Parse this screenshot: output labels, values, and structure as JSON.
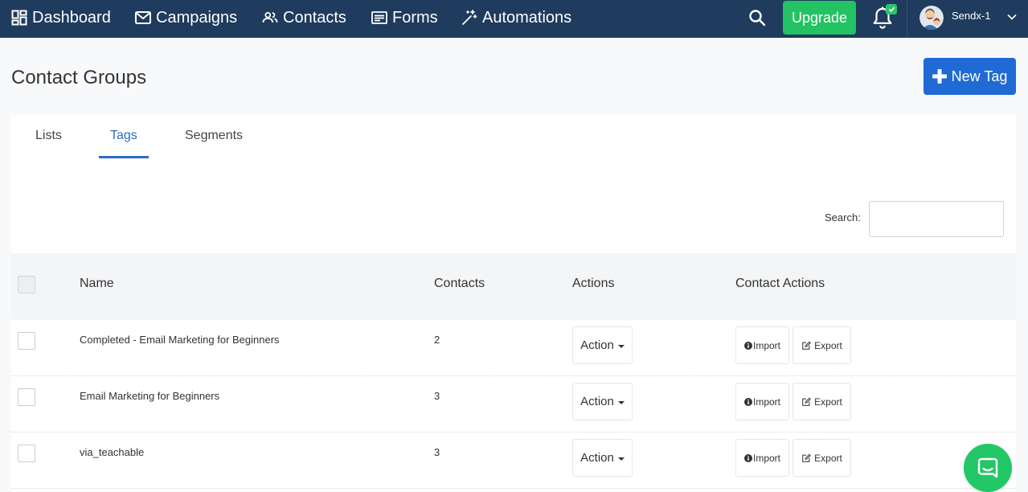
{
  "colors": {
    "nav_bg": "#1f3b5d",
    "primary_blue": "#1f6ad4",
    "tab_active": "#2e6bc6",
    "upgrade_green": "#23c262",
    "badge_green": "#2bc46a",
    "chat_green": "#22c768"
  },
  "nav": {
    "items": [
      {
        "label": "Dashboard",
        "icon": "dashboard-icon"
      },
      {
        "label": "Campaigns",
        "icon": "envelope-icon"
      },
      {
        "label": "Contacts",
        "icon": "people-icon"
      },
      {
        "label": "Forms",
        "icon": "form-icon"
      },
      {
        "label": "Automations",
        "icon": "magic-wand-icon"
      }
    ],
    "search_icon": "search-icon",
    "upgrade_label": "Upgrade",
    "notifications_icon": "bell-icon",
    "notifications_badge_icon": "check-icon",
    "user_name": "Sendx-1",
    "user_menu_icon": "chevron-down-icon"
  },
  "page": {
    "title": "Contact Groups",
    "new_tag_label": "New Tag",
    "new_tag_icon": "plus-icon"
  },
  "tabs": [
    {
      "label": "Lists",
      "active": false
    },
    {
      "label": "Tags",
      "active": true
    },
    {
      "label": "Segments",
      "active": false
    }
  ],
  "search": {
    "label": "Search:",
    "value": ""
  },
  "table": {
    "columns": [
      "Name",
      "Contacts",
      "Actions",
      "Contact Actions"
    ],
    "select_all_checked": false,
    "rows": [
      {
        "name": "Completed - Email Marketing for Beginners",
        "contacts": "2",
        "action_label": "Action",
        "import_label": "Import",
        "export_label": "Export",
        "selected": false
      },
      {
        "name": "Email Marketing for Beginners",
        "contacts": "3",
        "action_label": "Action",
        "import_label": "Import",
        "export_label": "Export",
        "selected": false
      },
      {
        "name": "via_teachable",
        "contacts": "3",
        "action_label": "Action",
        "import_label": "Import",
        "export_label": "Export",
        "selected": false
      }
    ]
  },
  "chat_widget": {
    "icon": "chat-icon"
  }
}
